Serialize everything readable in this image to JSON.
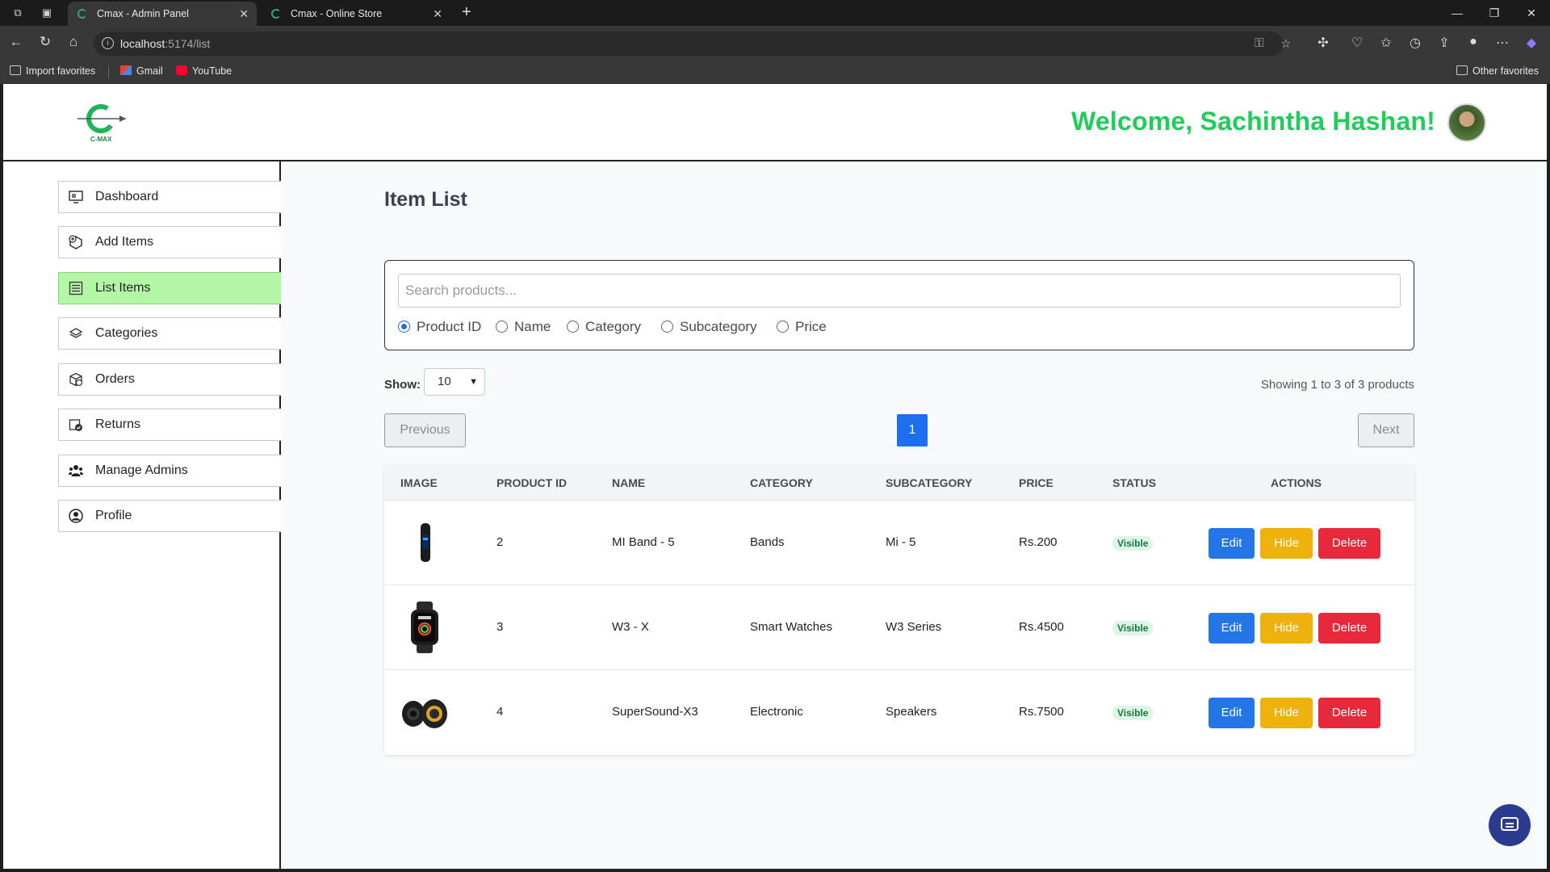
{
  "browser": {
    "tabs": [
      {
        "title": "Cmax - Admin Panel",
        "active": true
      },
      {
        "title": "Cmax - Online Store",
        "active": false
      }
    ],
    "url_host": "localhost",
    "url_path": ":5174/list",
    "bookmarks": [
      "Import favorites",
      "Gmail",
      "YouTube"
    ],
    "other_favorites": "Other favorites"
  },
  "header": {
    "logo_text": "C-MAX",
    "welcome": "Welcome, Sachintha Hashan!"
  },
  "sidebar": {
    "items": [
      {
        "label": "Dashboard",
        "icon": "dashboard-icon"
      },
      {
        "label": "Add Items",
        "icon": "add-box-icon"
      },
      {
        "label": "List Items",
        "icon": "list-icon"
      },
      {
        "label": "Categories",
        "icon": "layers-icon"
      },
      {
        "label": "Orders",
        "icon": "orders-icon"
      },
      {
        "label": "Returns",
        "icon": "returns-icon"
      },
      {
        "label": "Manage Admins",
        "icon": "users-icon"
      },
      {
        "label": "Profile",
        "icon": "user-circle-icon"
      }
    ],
    "active_item": "List Items"
  },
  "main": {
    "title": "Item List",
    "search": {
      "placeholder": "Search products...",
      "filters": [
        "Product ID",
        "Name",
        "Category",
        "Subcategory",
        "Price"
      ],
      "selected_filter": "Product ID"
    },
    "show_label": "Show:",
    "show_value": "10",
    "count_text": "Showing 1 to 3 of 3 products",
    "pagination": {
      "previous": "Previous",
      "next": "Next",
      "current_page": "1"
    },
    "table": {
      "columns": [
        "IMAGE",
        "PRODUCT ID",
        "NAME",
        "CATEGORY",
        "SUBCATEGORY",
        "PRICE",
        "STATUS",
        "ACTIONS"
      ],
      "rows": [
        {
          "image": "fitness-band-image",
          "id": "2",
          "name": "MI Band - 5",
          "category": "Bands",
          "subcategory": "Mi - 5",
          "price": "Rs.200",
          "status": "Visible"
        },
        {
          "image": "smartwatch-image",
          "id": "3",
          "name": "W3 - X",
          "category": "Smart Watches",
          "subcategory": "W3 Series",
          "price": "Rs.4500",
          "status": "Visible"
        },
        {
          "image": "speakers-image",
          "id": "4",
          "name": "SuperSound-X3",
          "category": "Electronic",
          "subcategory": "Speakers",
          "price": "Rs.7500",
          "status": "Visible"
        }
      ],
      "action_labels": {
        "edit": "Edit",
        "hide": "Hide",
        "delete": "Delete"
      }
    }
  },
  "colors": {
    "welcome": "#1fce5a",
    "active_sidebar": "#b3f7a6",
    "primary": "#1d6ff2",
    "edit": "#2476e8",
    "hide": "#efb20c",
    "delete": "#e8283b",
    "visible_badge_bg": "#dcf5e4",
    "chat_fab": "#2a3b90"
  }
}
